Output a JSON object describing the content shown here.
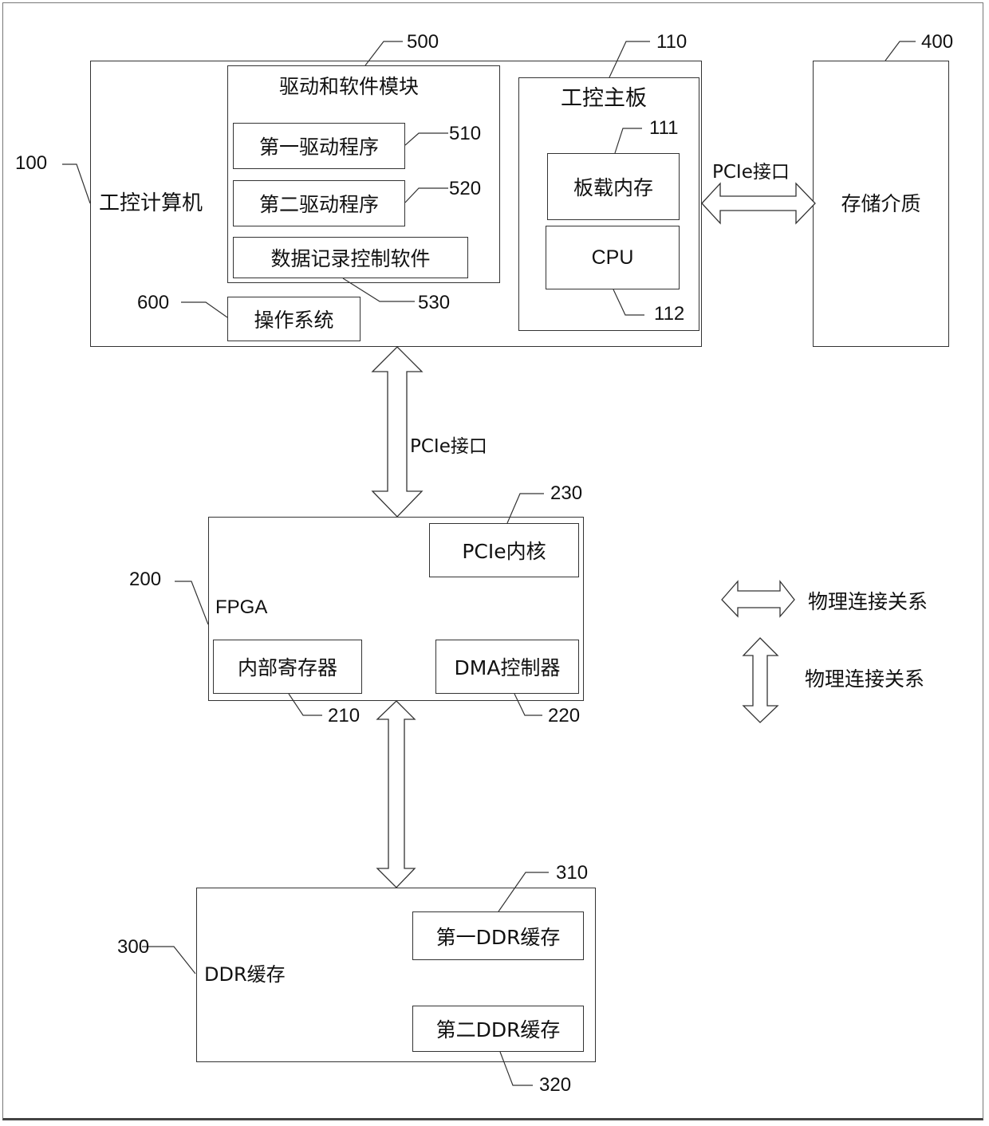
{
  "blocks": {
    "ipc": {
      "label": "工控计算机",
      "ref": "100"
    },
    "driver_module": {
      "label": "驱动和软件模块",
      "ref": "500"
    },
    "driver1": {
      "label": "第一驱动程序",
      "ref": "510"
    },
    "driver2": {
      "label": "第二驱动程序",
      "ref": "520"
    },
    "record_sw": {
      "label": "数据记录控制软件",
      "ref": "530"
    },
    "os": {
      "label": "操作系统",
      "ref": "600"
    },
    "mainboard": {
      "label": "工控主板",
      "ref": "110"
    },
    "onboard_mem": {
      "label": "板载内存",
      "ref": "111"
    },
    "cpu": {
      "label": "CPU",
      "ref": "112"
    },
    "storage": {
      "label": "存储介质",
      "ref": "400"
    },
    "fpga": {
      "label": "FPGA",
      "ref": "200"
    },
    "pcie_core": {
      "label": "PCIe内核",
      "ref": "230"
    },
    "internal_reg": {
      "label": "内部寄存器",
      "ref": "210"
    },
    "dma": {
      "label": "DMA控制器",
      "ref": "220"
    },
    "ddr": {
      "label": "DDR缓存",
      "ref": "300"
    },
    "ddr1": {
      "label": "第一DDR缓存",
      "ref": "310"
    },
    "ddr2": {
      "label": "第二DDR缓存",
      "ref": "320"
    }
  },
  "connections": {
    "board_storage": {
      "label": "PCIe接口"
    },
    "ipc_fpga": {
      "label": "PCIe接口"
    },
    "fpga_ddr": {
      "label": ""
    }
  },
  "legend": [
    {
      "symbol": "horizontal-double-arrow",
      "label": "物理连接关系"
    },
    {
      "symbol": "vertical-double-arrow",
      "label": "物理连接关系"
    }
  ]
}
